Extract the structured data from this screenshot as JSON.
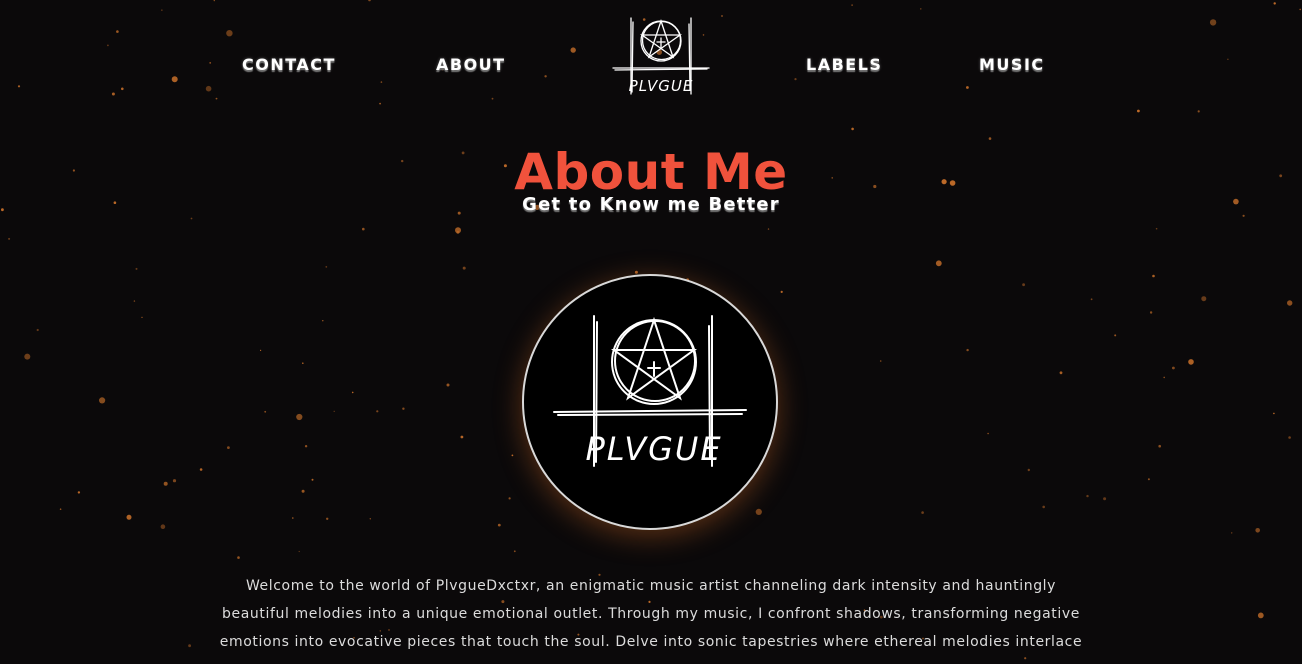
{
  "nav": {
    "contact": "CONTACT",
    "about": "ABOUT",
    "labels": "LABELS",
    "music": "MUSIC",
    "logo_text": "PLVGUE"
  },
  "hero": {
    "title": "About Me",
    "subtitle": "Get to Know me Better"
  },
  "profile": {
    "image_text": "PLVGUE"
  },
  "bio": {
    "text": "Welcome to the world of PlvgueDxctxr, an enigmatic music artist channeling dark intensity and hauntingly beautiful melodies into a unique emotional outlet. Through my music, I confront shadows, transforming negative emotions into evocative pieces that touch the soul. Delve into sonic tapestries where ethereal melodies interlace"
  },
  "colors": {
    "background": "#0b090a",
    "accent": "#f0523c",
    "star": "#c8702a",
    "text": "#dcdcdc"
  },
  "icons": {
    "logo": "pentagram-logo-icon"
  }
}
